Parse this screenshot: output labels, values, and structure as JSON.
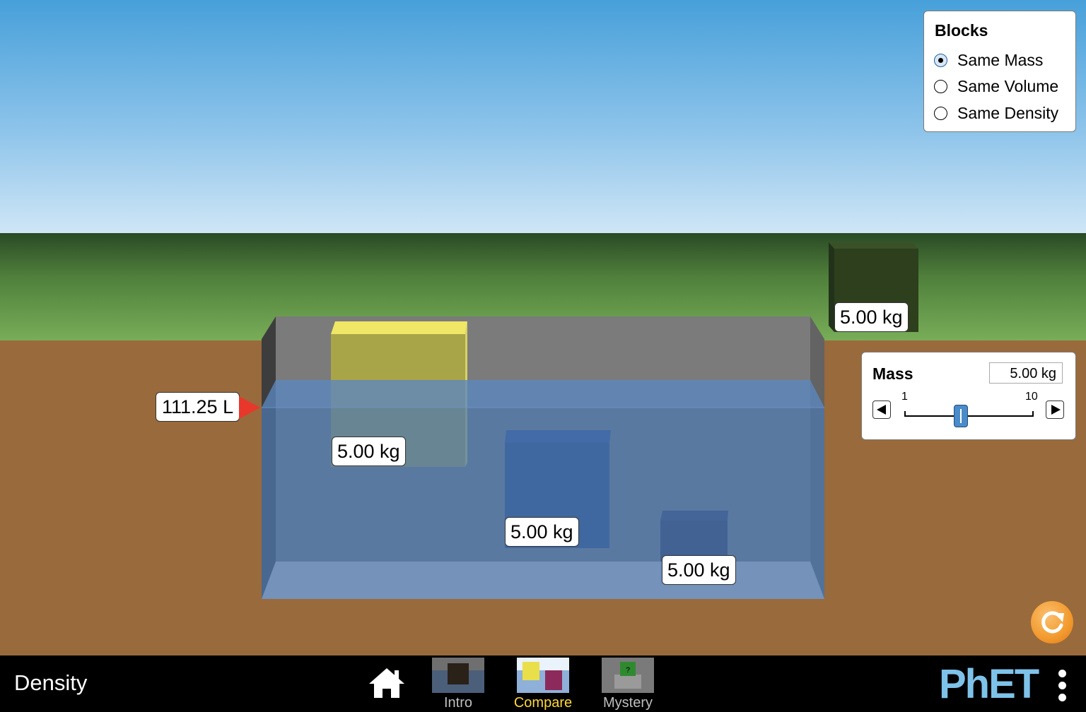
{
  "app": {
    "title": "Density"
  },
  "blocks_panel": {
    "title": "Blocks",
    "options": [
      {
        "label": "Same Mass",
        "selected": true
      },
      {
        "label": "Same Volume",
        "selected": false
      },
      {
        "label": "Same Density",
        "selected": false
      }
    ]
  },
  "mass_control": {
    "title": "Mass",
    "value": "5.00 kg",
    "min_label": "1",
    "max_label": "10",
    "slider_value": 5.0
  },
  "pool": {
    "volume_label": "111.25 L"
  },
  "blocks": [
    {
      "id": "yellow",
      "mass_label": "5.00 kg",
      "color": "#c9c446"
    },
    {
      "id": "blue",
      "mass_label": "5.00 kg",
      "color": "#1f3f7a"
    },
    {
      "id": "navy",
      "mass_label": "5.00 kg",
      "color": "#232a4a"
    },
    {
      "id": "green",
      "mass_label": "5.00 kg",
      "color": "#2d3f1c"
    }
  ],
  "navbar": {
    "tabs": [
      {
        "label": "Intro",
        "active": false
      },
      {
        "label": "Compare",
        "active": true
      },
      {
        "label": "Mystery",
        "active": false
      }
    ],
    "logo_text": "PhET"
  },
  "colors": {
    "water": "#4d78b0",
    "pointer": "#e8372b",
    "active_tab": "#ffd83a",
    "reset": "#f29a2e"
  }
}
